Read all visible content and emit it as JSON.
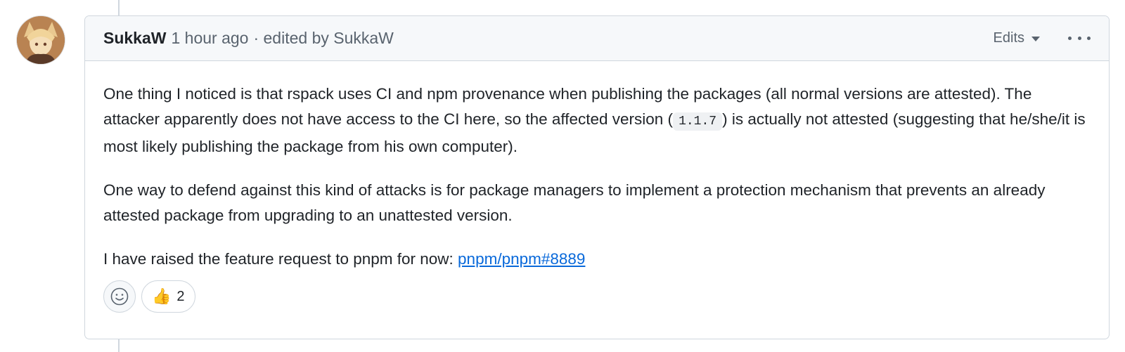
{
  "comment": {
    "author": "SukkaW",
    "timestamp": "1 hour ago",
    "edited_text": "· edited by SukkaW",
    "edits_label": "Edits",
    "menu_icon": "kebab-horizontal-icon",
    "body": {
      "p1_before": "One thing I noticed is that rspack uses CI and npm provenance when publishing the packages (all normal versions are attested). The attacker apparently does not have access to the CI here, so the affected version (",
      "p1_code": "1.1.7",
      "p1_after": ") is actually not attested (suggesting that he/she/it is most likely publishing the package from his own computer).",
      "p2": "One way to defend against this kind of attacks is for package managers to implement a protection mechanism that prevents an already attested package from upgrading to an unattested version.",
      "p3_before": "I have raised the feature request to pnpm for now: ",
      "p3_link": "pnpm/pnpm#8889"
    },
    "reactions": {
      "add_icon": "smiley-icon",
      "items": [
        {
          "emoji": "👍",
          "count": "2"
        }
      ]
    }
  },
  "colors": {
    "link": "#0969da",
    "border": "#d0d7de",
    "header_bg": "#f6f8fa",
    "muted_text": "#59636e"
  }
}
